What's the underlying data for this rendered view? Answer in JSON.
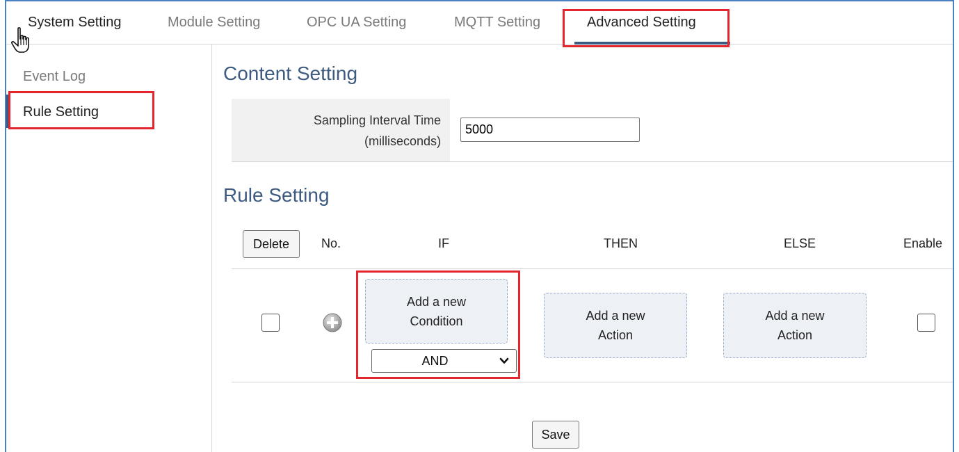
{
  "tabs": [
    {
      "label": "System Setting"
    },
    {
      "label": "Module Setting"
    },
    {
      "label": "OPC UA Setting"
    },
    {
      "label": "MQTT Setting"
    },
    {
      "label": "Advanced Setting",
      "active": true
    }
  ],
  "sidebar": {
    "items": [
      {
        "label": "Event Log"
      },
      {
        "label": "Rule Setting",
        "active": true
      }
    ]
  },
  "content": {
    "title": "Content Setting",
    "sampling": {
      "label_line1": "Sampling Interval Time",
      "label_line2": "(milliseconds)",
      "value": "5000"
    }
  },
  "rules": {
    "title": "Rule Setting",
    "delete_label": "Delete",
    "columns": {
      "no": "No.",
      "if": "IF",
      "then": "THEN",
      "else": "ELSE",
      "enable": "Enable"
    },
    "row": {
      "condition_line1": "Add a new",
      "condition_line2": "Condition",
      "logic_selected": "AND",
      "then_line1": "Add a new",
      "then_line2": "Action",
      "else_line1": "Add a new",
      "else_line2": "Action",
      "selected": false,
      "enabled": false
    },
    "save_label": "Save"
  },
  "colors": {
    "accent": "#3d5a80",
    "highlight": "#e3262d",
    "frame": "#4a7fc0"
  },
  "icons": [
    "hand-pointer-icon",
    "plus-circle-icon",
    "chevron-down-icon"
  ]
}
